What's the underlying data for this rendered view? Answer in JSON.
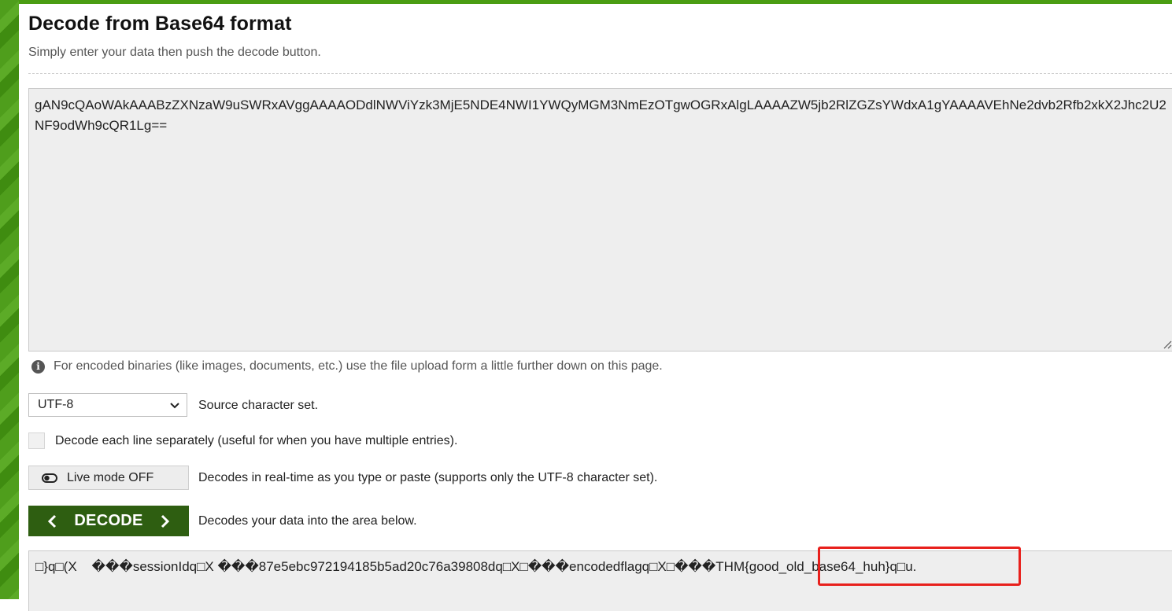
{
  "page": {
    "title": "Decode from Base64 format",
    "subtitle": "Simply enter your data then push the decode button."
  },
  "input": {
    "value": "gAN9cQAoWAkAAABzZXNzaW9uSWRxAVggAAAAODdlNWViYzk3MjE5NDE4NWI1YWQyMGM3NmEzOTgwOGRxAlgLAAAAZW5jb2RlZGZsYWdxA1gYAAAAVEhNe2dvb2Rfb2xkX2Jhc2U2NF9odWh9cQR1Lg=="
  },
  "info_note": "For encoded binaries (like images, documents, etc.) use the file upload form a little further down on this page.",
  "charset": {
    "selected": "UTF-8",
    "label": "Source character set."
  },
  "line_option": {
    "label": "Decode each line separately (useful for when you have multiple entries)."
  },
  "live_mode": {
    "button_label": "Live mode OFF",
    "description": "Decodes in real-time as you type or paste (supports only the UTF-8 character set)."
  },
  "decode": {
    "button_label": "DECODE",
    "description": "Decodes your data into the area below."
  },
  "output": {
    "prefix": "□}q□(X    ���sessionIdq□X ���87e5ebc972194185b5ad20c76a39808dq□X□���encodedflagq□X□���",
    "flag": "THM{good_old_base64_huh}",
    "suffix": "q□u."
  },
  "colors": {
    "accent_green": "#2e5e11",
    "side_green": "#4f9e1c",
    "highlight_red": "#e8201c"
  }
}
